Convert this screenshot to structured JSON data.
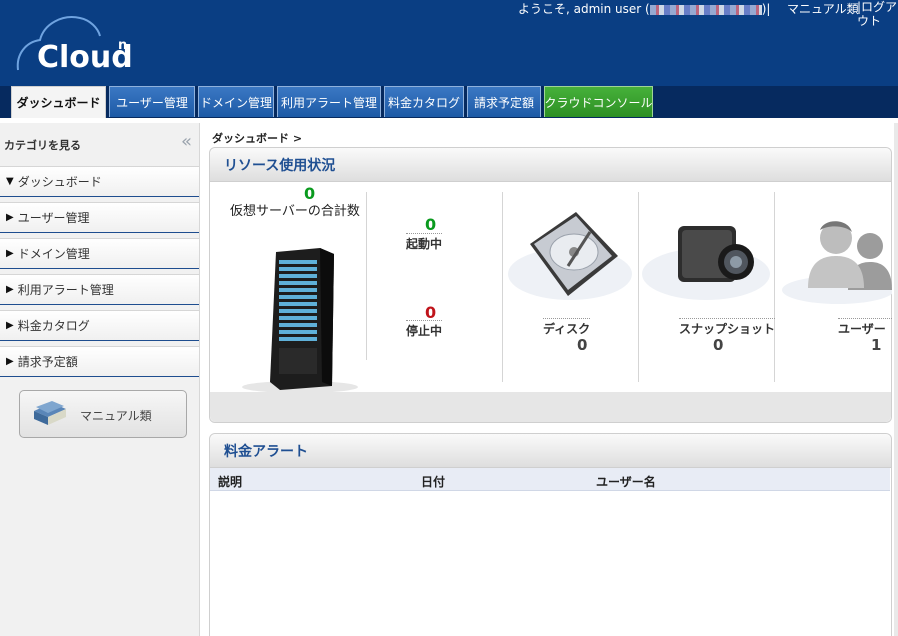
{
  "header": {
    "logo_text": "Cloud",
    "logo_sup": "n",
    "welcome": "ようこそ, admin user (",
    "welcome_end": ")|",
    "manual_link": "マニュアル類",
    "logout_link": "|ログアウト"
  },
  "tabs": [
    {
      "label": "ダッシュボード"
    },
    {
      "label": "ユーザー管理"
    },
    {
      "label": "ドメイン管理"
    },
    {
      "label": "利用アラート管理"
    },
    {
      "label": "料金カタログ"
    },
    {
      "label": "請求予定額"
    },
    {
      "label": "クラウドコンソール"
    }
  ],
  "sidebar": {
    "title": "カテゴリを見る",
    "collapse_icon": "«",
    "items": [
      {
        "label": "ダッシュボード",
        "arrow": "▼"
      },
      {
        "label": "ユーザー管理",
        "arrow": "▶"
      },
      {
        "label": "ドメイン管理",
        "arrow": "▶"
      },
      {
        "label": "利用アラート管理",
        "arrow": "▶"
      },
      {
        "label": "料金カタログ",
        "arrow": "▶"
      },
      {
        "label": "請求予定額",
        "arrow": "▶"
      }
    ],
    "manual_button": "マニュアル類"
  },
  "breadcrumb": "ダッシュボード >",
  "resources": {
    "title": "リソース使用状況",
    "vm_total": "0",
    "vm_label": "仮想サーバーの合計数",
    "running_count": "0",
    "running_label": "起動中",
    "stopped_count": "0",
    "stopped_label": "停止中",
    "disk_label": "ディスク",
    "disk_count": "0",
    "snapshot_label": "スナップショット",
    "snapshot_count": "0",
    "user_label": "ユーザー",
    "user_count": "1",
    "colors": {
      "running": "#0a9a1e",
      "stopped": "#c0141b"
    }
  },
  "alerts": {
    "title": "料金アラート",
    "columns": [
      "説明",
      "日付",
      "ユーザー名"
    ]
  },
  "icons": [
    "server-icon",
    "hard-disk-icon",
    "camera-icon",
    "users-icon",
    "book-icon",
    "cloud-logo-icon"
  ]
}
